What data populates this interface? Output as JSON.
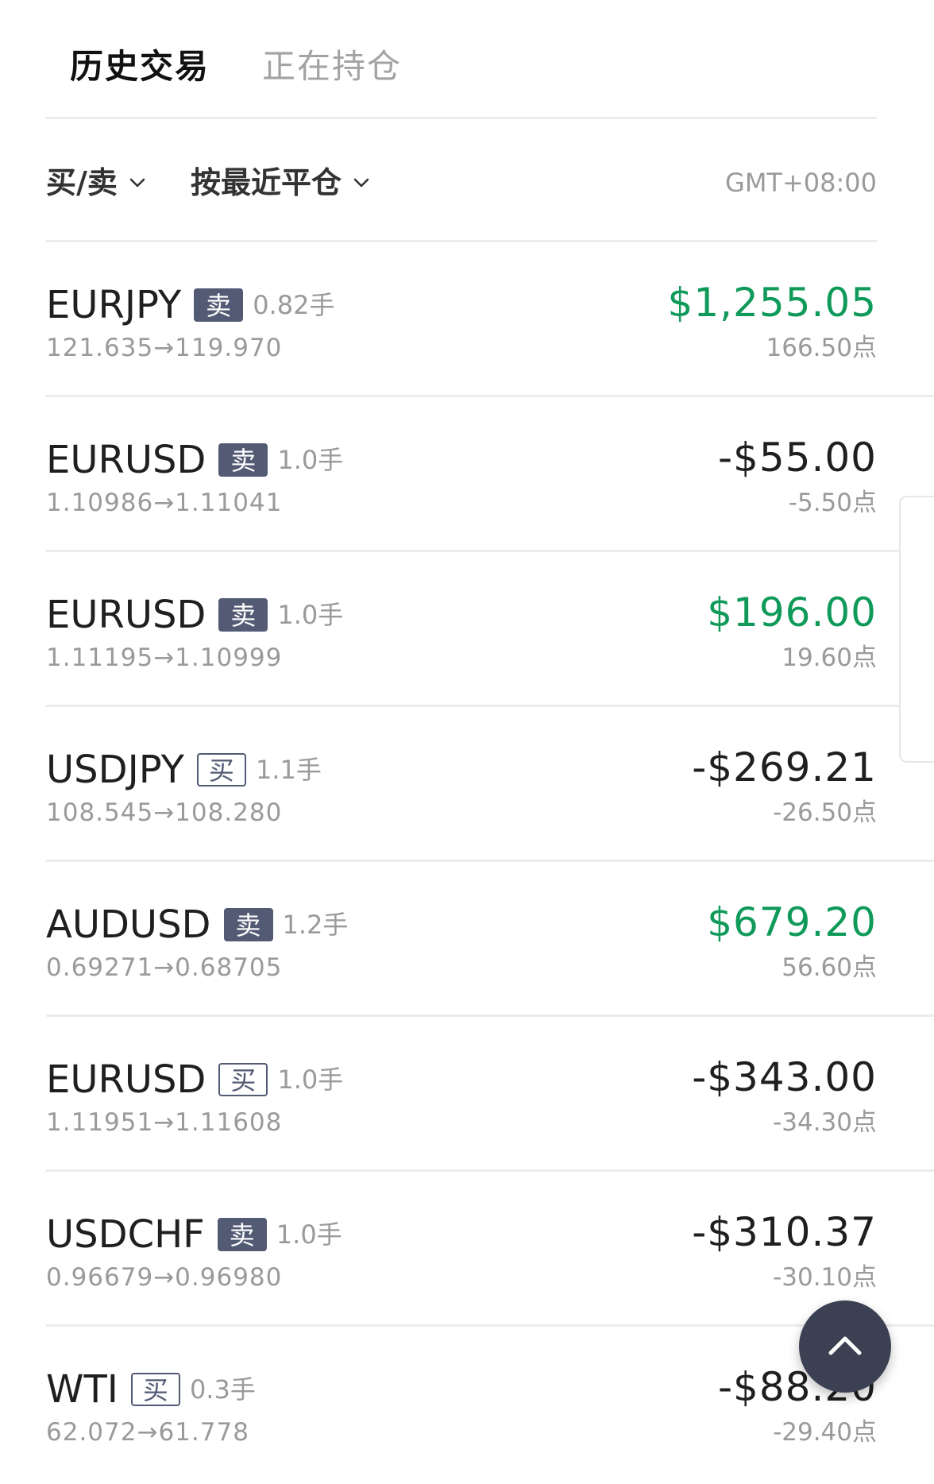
{
  "tabs": [
    {
      "label": "历史交易"
    },
    {
      "label": "正在持仓"
    }
  ],
  "filters": {
    "side_label": "买/卖",
    "sort_label": "按最近平仓",
    "timezone": "GMT+08:00"
  },
  "colors": {
    "profit": "#0f9a5a",
    "loss": "#1f1f1f",
    "badge": "#525a74",
    "fab": "#3b4152"
  },
  "trades": [
    {
      "symbol": "EURJPY",
      "side": "卖",
      "side_type": "sell",
      "lots": "0.82手",
      "prices": "121.635→119.970",
      "pnl": "$1,255.05",
      "pnl_sign": "positive",
      "points": "166.50点"
    },
    {
      "symbol": "EURUSD",
      "side": "卖",
      "side_type": "sell",
      "lots": "1.0手",
      "prices": "1.10986→1.11041",
      "pnl": "-$55.00",
      "pnl_sign": "negative",
      "points": "-5.50点"
    },
    {
      "symbol": "EURUSD",
      "side": "卖",
      "side_type": "sell",
      "lots": "1.0手",
      "prices": "1.11195→1.10999",
      "pnl": "$196.00",
      "pnl_sign": "positive",
      "points": "19.60点"
    },
    {
      "symbol": "USDJPY",
      "side": "买",
      "side_type": "buy",
      "lots": "1.1手",
      "prices": "108.545→108.280",
      "pnl": "-$269.21",
      "pnl_sign": "negative",
      "points": "-26.50点"
    },
    {
      "symbol": "AUDUSD",
      "side": "卖",
      "side_type": "sell",
      "lots": "1.2手",
      "prices": "0.69271→0.68705",
      "pnl": "$679.20",
      "pnl_sign": "positive",
      "points": "56.60点"
    },
    {
      "symbol": "EURUSD",
      "side": "买",
      "side_type": "buy",
      "lots": "1.0手",
      "prices": "1.11951→1.11608",
      "pnl": "-$343.00",
      "pnl_sign": "negative",
      "points": "-34.30点"
    },
    {
      "symbol": "USDCHF",
      "side": "卖",
      "side_type": "sell",
      "lots": "1.0手",
      "prices": "0.96679→0.96980",
      "pnl": "-$310.37",
      "pnl_sign": "negative",
      "points": "-30.10点"
    },
    {
      "symbol": "WTI",
      "side": "买",
      "side_type": "buy",
      "lots": "0.3手",
      "prices": "62.072→61.778",
      "pnl": "-$88.20",
      "pnl_sign": "negative",
      "points": "-29.40点"
    }
  ],
  "icons": {
    "side_filter_chevron": "chevron-down-icon",
    "sort_filter_chevron": "chevron-down-icon",
    "scroll_top": "chevron-up-icon"
  }
}
